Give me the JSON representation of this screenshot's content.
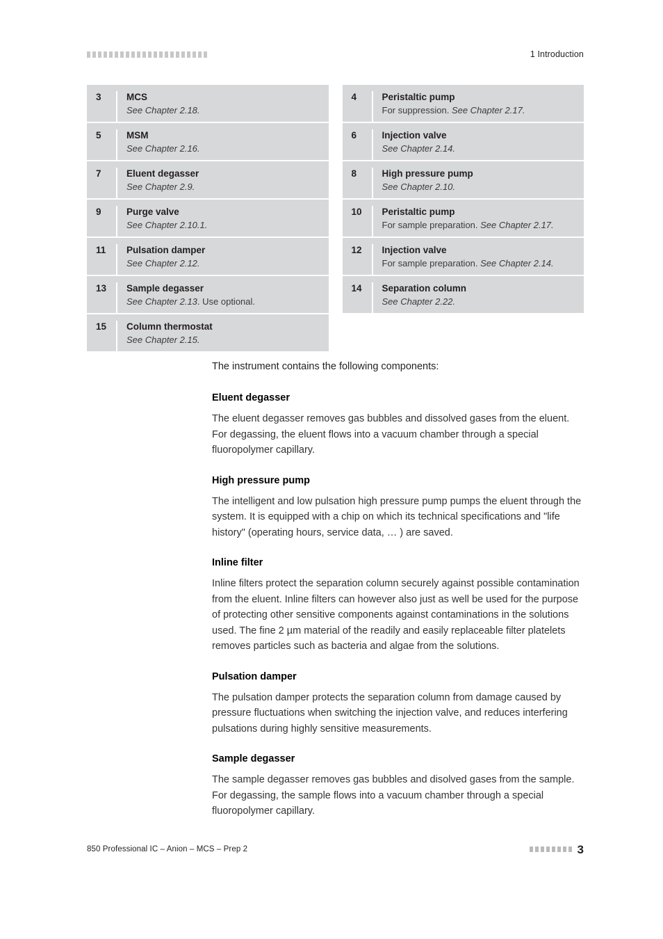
{
  "header": {
    "rule_squares": 22,
    "chapter": "1 Introduction"
  },
  "legend": {
    "left_column": [
      {
        "number": "3",
        "title": "MCS",
        "sub_plain_before": "",
        "sub_italic": "See Chapter 2.18.",
        "sub_plain_after": ""
      },
      {
        "number": "5",
        "title": "MSM",
        "sub_plain_before": "",
        "sub_italic": "See Chapter 2.16.",
        "sub_plain_after": ""
      },
      {
        "number": "7",
        "title": "Eluent degasser",
        "sub_plain_before": "",
        "sub_italic": "See Chapter 2.9.",
        "sub_plain_after": ""
      },
      {
        "number": "9",
        "title": "Purge valve",
        "sub_plain_before": "",
        "sub_italic": "See Chapter 2.10.1.",
        "sub_plain_after": ""
      },
      {
        "number": "11",
        "title": "Pulsation damper",
        "sub_plain_before": "",
        "sub_italic": "See Chapter 2.12.",
        "sub_plain_after": ""
      },
      {
        "number": "13",
        "title": "Sample degasser",
        "sub_plain_before": "",
        "sub_italic": "See Chapter 2.13",
        "sub_plain_after": ". Use optional."
      },
      {
        "number": "15",
        "title": "Column thermostat",
        "sub_plain_before": "",
        "sub_italic": "See Chapter 2.15.",
        "sub_plain_after": ""
      }
    ],
    "right_column": [
      {
        "number": "4",
        "title": "Peristaltic pump",
        "sub_plain_before": "For suppression. ",
        "sub_italic": "See Chapter 2.17.",
        "sub_plain_after": ""
      },
      {
        "number": "6",
        "title": "Injection valve",
        "sub_plain_before": "",
        "sub_italic": "See Chapter 2.14.",
        "sub_plain_after": ""
      },
      {
        "number": "8",
        "title": "High pressure pump",
        "sub_plain_before": "",
        "sub_italic": "See Chapter 2.10.",
        "sub_plain_after": ""
      },
      {
        "number": "10",
        "title": "Peristaltic pump",
        "sub_plain_before": "For sample preparation. ",
        "sub_italic": "See Chapter 2.17.",
        "sub_plain_after": ""
      },
      {
        "number": "12",
        "title": "Injection valve",
        "sub_plain_before": "For sample preparation. ",
        "sub_italic": "See Chapter 2.14.",
        "sub_plain_after": ""
      },
      {
        "number": "14",
        "title": "Separation column",
        "sub_plain_before": "",
        "sub_italic": "See Chapter 2.22.",
        "sub_plain_after": ""
      }
    ]
  },
  "content": {
    "lead": "The instrument contains the following components:",
    "sections": [
      {
        "heading": "Eluent degasser",
        "text": "The eluent degasser removes gas bubbles and dissolved gases from the eluent. For degassing, the eluent flows into a vacuum chamber through a special fluoropolymer capillary."
      },
      {
        "heading": "High pressure pump",
        "text": "The intelligent and low pulsation high pressure pump pumps the eluent through the system. It is equipped with a chip on which its technical specifications and \"life history\" (operating hours, service data, … ) are saved."
      },
      {
        "heading": "Inline filter",
        "text": "Inline filters protect the separation column securely against possible contamination from the eluent. Inline filters can however also just as well be used for the purpose of protecting other sensitive components against contaminations in the solutions used. The fine 2 µm material of the readily and easily replaceable filter platelets removes particles such as bacteria and algae from the solutions."
      },
      {
        "heading": "Pulsation damper",
        "text": "The pulsation damper protects the separation column from damage caused by pressure fluctuations when switching the injection valve, and reduces interfering pulsations during highly sensitive measurements."
      },
      {
        "heading": "Sample degasser",
        "text": "The sample degasser removes gas bubbles and disolved gases from the sample. For degassing, the sample flows into a vacuum chamber through a special fluoropolymer capillary."
      }
    ]
  },
  "footer": {
    "document": "850 Professional IC – Anion – MCS – Prep 2",
    "rule_squares": 8,
    "page_number": "3"
  },
  "colors": {
    "row_background": "#d7d8d9",
    "rule_square": "#c6c7c8",
    "text": "#231f20"
  }
}
